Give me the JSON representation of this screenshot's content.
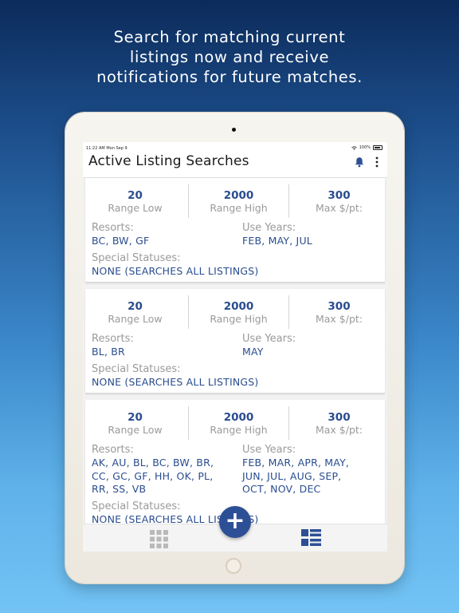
{
  "promo": {
    "line1": "Search for matching current",
    "line2": "listings now and receive",
    "line3": "notifications for future matches."
  },
  "status_bar": {
    "time": "11:22 AM  Mon Sep 9",
    "battery": "100%"
  },
  "header": {
    "title": "Active Listing Searches",
    "bell_icon": "bell-icon",
    "more_icon": "more-vertical-icon"
  },
  "labels": {
    "range_low": "Range Low",
    "range_high": "Range High",
    "max_per_pt": "Max $/pt:",
    "resorts": "Resorts:",
    "use_years": "Use Years:",
    "special_statuses": "Special Statuses:"
  },
  "searches": [
    {
      "range_low": "20",
      "range_high": "2000",
      "max_price": "300",
      "resorts": [
        "BC, BW, GF"
      ],
      "use_years": [
        "FEB, MAY, JUL"
      ],
      "special_statuses": "NONE (SEARCHES ALL LISTINGS)"
    },
    {
      "range_low": "20",
      "range_high": "2000",
      "max_price": "300",
      "resorts": [
        "BL, BR"
      ],
      "use_years": [
        "MAY"
      ],
      "special_statuses": "NONE (SEARCHES ALL LISTINGS)"
    },
    {
      "range_low": "20",
      "range_high": "2000",
      "max_price": "300",
      "resorts": [
        "AK, AU, BL, BC, BW, BR,",
        "CC, GC, GF, HH, OK, PL,",
        "RR, SS, VB"
      ],
      "use_years": [
        "FEB, MAR, APR, MAY,",
        "JUN, JUL, AUG, SEP,",
        "OCT, NOV, DEC"
      ],
      "special_statuses": "NONE (SEARCHES ALL LISTINGS)"
    }
  ],
  "fab": {
    "label": "+"
  },
  "tab_bar": {
    "tabs": [
      {
        "icon": "grid-icon"
      },
      {
        "icon": "list-icon",
        "active": true
      }
    ]
  },
  "colors": {
    "accent": "#2a4d8f",
    "label_gray": "#9a9a9a",
    "fab": "#2d4f96"
  }
}
